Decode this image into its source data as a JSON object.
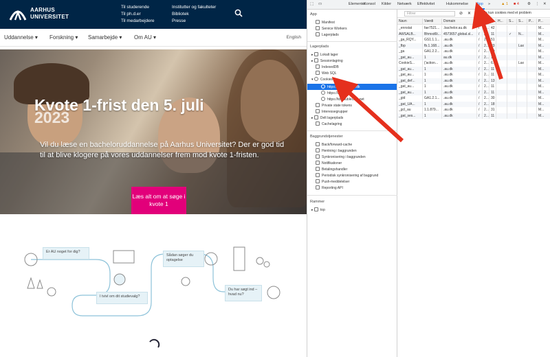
{
  "site": {
    "logo_line1": "AARHUS",
    "logo_line2": "UNIVERSITET",
    "header_col1": [
      "Til studerende",
      "Til ph.d.er",
      "Til medarbejdere"
    ],
    "header_col2": [
      "Institutter og fakulteter",
      "Bibliotek",
      "Presse"
    ],
    "nav": [
      "Uddannelse",
      "Forskning",
      "Samarbejde",
      "Om AU"
    ],
    "language": "English",
    "hero_title": "Kvote 1-frist den 5. juli",
    "hero_title_ghost": "2023",
    "hero_text": "Vil du læse en bacheloruddannelse på Aarhus Universitet? Der er god tid til at blive klogere på vores uddannelser frem mod kvote 1-fristen.",
    "hero_cta": "Læs alt om at søge i kvote 1",
    "flow_boxes": [
      "Er AU noget for dig?",
      "Sådan søger du optagelse",
      "I tvivl om dit studievalg?",
      "Du har søgt ind – hvad nu?"
    ]
  },
  "devtools": {
    "tabs": [
      "Elementer",
      "Konsol",
      "Kilder",
      "Netværk",
      "Effektivitet",
      "Hukommelse",
      "App"
    ],
    "active_tab": "App",
    "warnings": "1",
    "errors": "4",
    "sidebar": {
      "section_app": "App",
      "app_items": [
        "Manifest",
        "Service Workers",
        "Lagerplads"
      ],
      "section_storage": "Lagerplads",
      "storage_items": [
        "Lokalt lager",
        "Sessionlagring",
        "IndexedDB",
        "Web SQL",
        "Cookies"
      ],
      "cookie_items": [
        "https://bachelor.au.dk",
        "https://au.dk",
        "https://td.doubleclick.net"
      ],
      "storage_items2": [
        "Private state tokens",
        "Interessegrupper",
        "Delt lagerplads",
        "Cachelagring"
      ],
      "section_bg": "Baggrundstjenester",
      "bg_items": [
        "Back/forward-cache",
        "Hentning i baggrunden",
        "Synkronisering i baggrunden",
        "Notifikationer",
        "Betalingshandler",
        "Periodisk synkronisering af baggrund",
        "Push-meddelelser",
        "Reporting API"
      ],
      "section_frames": "Rammer",
      "frame_items": [
        "top"
      ]
    },
    "filter_placeholder": "Filtrer",
    "only_problem_cookies": "Vis kun cookies med et problem",
    "columns": [
      "Navn",
      "Værdi",
      "Domain",
      "P",
      "E...",
      "S...",
      "H...",
      "S...",
      "S...",
      "P...",
      "P..."
    ],
    "rows": [
      [
        "_ennstat",
        "fae7521...",
        ".bachelor.au.dk",
        "/",
        "2...",
        "42",
        "",
        "",
        "",
        "",
        "M..."
      ],
      [
        "AWSALB...",
        "Bhmxd6t...",
        "4573657.global.sl...",
        "/",
        "2...",
        "11",
        "",
        "✓",
        "N...",
        "",
        "M..."
      ],
      [
        "_ga_RQY...",
        "GS1.1.1...",
        ".au.dk",
        "/",
        "2...",
        "51",
        "",
        "",
        "",
        "",
        "M..."
      ],
      [
        "_fbp",
        "fb.1.168...",
        ".au.dk",
        "/",
        "2...",
        "33",
        "",
        "",
        "Lax",
        "",
        "M..."
      ],
      [
        "_ga",
        "GA1.2.2...",
        ".au.dk",
        "/",
        "2...",
        "29",
        "",
        "",
        "",
        "",
        "M..."
      ],
      [
        "_gat_au...",
        "1",
        "au.dk",
        "/",
        "2...",
        "11",
        "",
        "",
        "",
        "",
        "M..."
      ],
      [
        "CookieS...",
        "{'action...",
        ".au.dk",
        "/",
        "2...",
        "6...",
        "",
        "",
        "Lax",
        "",
        "M..."
      ],
      [
        "_gat_au...",
        "1",
        ".au.dk",
        "/",
        "2...",
        "11",
        "",
        "",
        "",
        "",
        "M..."
      ],
      [
        "_gat_au...",
        "1",
        ".au.dk",
        "/",
        "2...",
        "11",
        "",
        "",
        "",
        "",
        "M..."
      ],
      [
        "_gat_def...",
        "1",
        ".au.dk",
        "/",
        "2...",
        "13",
        "",
        "",
        "",
        "",
        "M..."
      ],
      [
        "_gat_au...",
        "1",
        ".au.dk",
        "/",
        "2...",
        "11",
        "",
        "",
        "",
        "",
        "M..."
      ],
      [
        "_gat_au...",
        "1",
        ".au.dk",
        "/",
        "2...",
        "11",
        "",
        "",
        "",
        "",
        "M..."
      ],
      [
        "_gid",
        "GA1.2.1...",
        ".au.dk",
        "/",
        "2...",
        "30",
        "",
        "",
        "",
        "",
        "M..."
      ],
      [
        "_gat_UA...",
        "1",
        ".au.dk",
        "/",
        "2...",
        "18",
        "",
        "",
        "",
        "",
        "M..."
      ],
      [
        "_gcl_au",
        "1.1.879...",
        ".au.dk",
        "/",
        "2...",
        "31",
        "",
        "",
        "",
        "",
        "M..."
      ],
      [
        "_gat_ses...",
        "1",
        ".au.dk",
        "/",
        "2...",
        "11",
        "",
        "",
        "",
        "",
        "M..."
      ]
    ]
  },
  "colors": {
    "au_navy": "#002546",
    "cta_pink": "#e2007a",
    "devtools_blue": "#1a73e8",
    "annotation_red": "#e5301d"
  }
}
